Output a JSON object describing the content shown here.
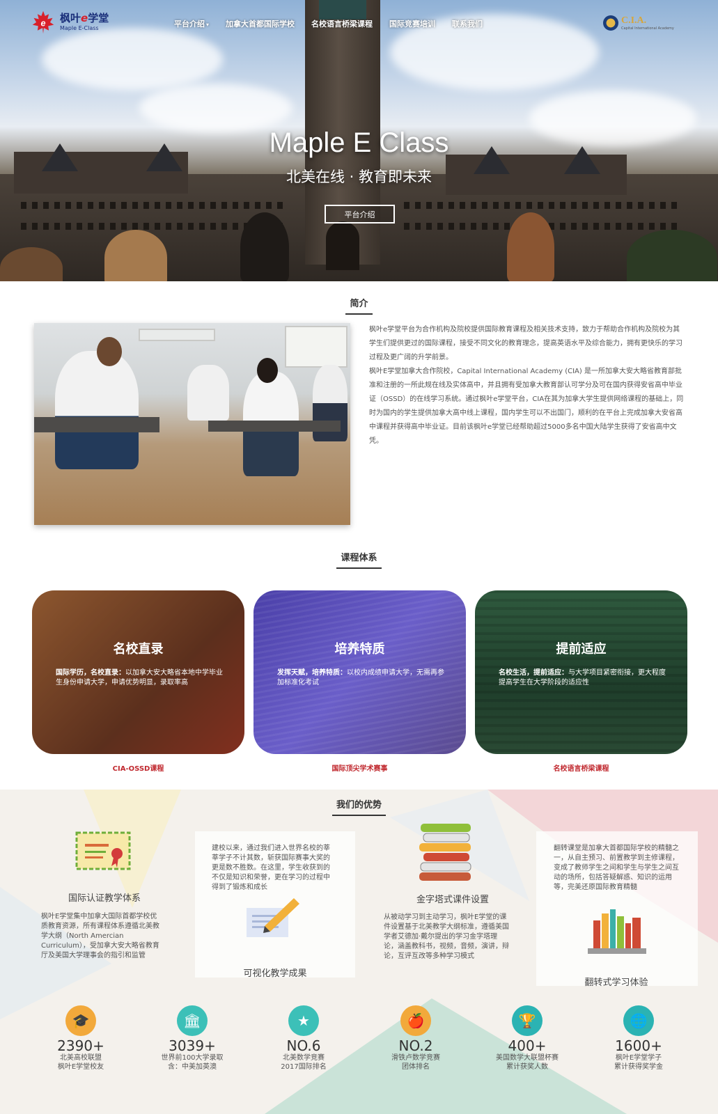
{
  "brand": {
    "name_pre": "枫叶",
    "name_e": "e",
    "name_post": "学堂",
    "sub": "Maple E-Class"
  },
  "nav": {
    "items": [
      {
        "label": "平台介绍",
        "caret": "▾"
      },
      {
        "label": "加拿大首都国际学校"
      },
      {
        "label": "名校语言桥梁课程"
      },
      {
        "label": "国际竞赛培训"
      },
      {
        "label": "联系我们"
      }
    ]
  },
  "partner": {
    "name": "C.I.A.",
    "sub": "Capital International Academy"
  },
  "hero": {
    "title": "Maple E Class",
    "subtitle": "北美在线 · 教育即未来",
    "button": "平台介绍"
  },
  "intro": {
    "title": "简介",
    "paragraphs": [
      "枫叶e学堂平台为合作机构及院校提供国际教育课程及相关技术支持，致力于帮助合作机构及院校为其学生们提供更过的国际课程，接受不同文化的教育理念，提高英语水平及综合能力，拥有更快乐的学习过程及更广阔的升学前景。",
      "枫叶E学堂加拿大合作院校，Capital International Academy (CIA) 是一所加拿大安大略省教育部批准和注册的一所此规在线及实体高中，并且拥有受加拿大教育部认可学分及可在国内获得安省高中毕业证（OSSD）的在线学习系统。通过枫叶e学堂平台，CIA在其为加拿大学生提供网络课程的基础上，同时为国内的学生提供加拿大高中线上课程，国内学生可以不出国门，顺利的在平台上完成加拿大安省高中课程并获得高中毕业证。目前该枫叶e学堂已经帮助超过5000多名中国大陆学生获得了安省高中文凭。"
    ]
  },
  "courses": {
    "title": "课程体系",
    "cards": [
      {
        "heading": "名校直录",
        "lead": "国际学历，名校直录：",
        "text": "以加拿大安大略省本地中学毕业生身份申请大学，申请优势明显，录取率高",
        "link": "CIA-OSSD课程"
      },
      {
        "heading": "培养特质",
        "lead": "发挥天赋，培养特质：",
        "text": "以校内成绩申请大学，无需再参加标准化考试",
        "link": "国际顶尖学术赛事"
      },
      {
        "heading": "提前适应",
        "lead": "名校生活，提前适应：",
        "text": "与大学项目紧密衔接，更大程度提高学生在大学阶段的适应性",
        "link": "名校语言桥梁课程"
      }
    ]
  },
  "advantages": {
    "title": "我们的优势",
    "items": [
      {
        "heading": "国际认证教学体系",
        "text": "枫叶E学堂集中加拿大国际首都学校优质教育资源，所有课程体系遵循北美教学大纲（North Amercian Curriculum），受加拿大安大略省教育厅及美国大学理事会的指引和监管"
      },
      {
        "heading": "可视化教学成果",
        "text": "建校以来，通过我们进入世界名校的莘莘学子不计其数，斩获国际赛事大奖的更是数不胜数。在这里，学生收获到的不仅是知识和荣誉，更在学习的过程中得到了锻炼和成长"
      },
      {
        "heading": "金字塔式课件设置",
        "text": "从被动学习到主动学习，枫叶E学堂的课件设置基于北美教学大纲标准，遵循美国学者艾德加·戴尔提出的学习金字塔理论，涵盖教科书，视频，音频，演讲，辩论，互评互改等多种学习模式"
      },
      {
        "heading": "翻转式学习体验",
        "text": "翻转课堂是加拿大首都国际学校的精髓之一，从自主预习、前置教学到主修课程，变成了教师学生之间和学生与学生之间互动的场所，包括答疑解惑、知识的运用等，完美还原国际教育精髓"
      }
    ]
  },
  "stats": [
    {
      "number": "2390+",
      "label1": "北美高校联盟",
      "label2": "枫叶E学堂校友",
      "icon": "graduates-icon",
      "color": "#f2a93b"
    },
    {
      "number": "3039+",
      "label1": "世界前100大学录取",
      "label2": "含：中美加英澳",
      "icon": "university-icon",
      "color": "#3cc0b8"
    },
    {
      "number": "NO.6",
      "label1": "北美数学竞赛",
      "label2": "2017国际排名",
      "icon": "medal-icon",
      "color": "#3cc0b8"
    },
    {
      "number": "NO.2",
      "label1": "滑铁卢数学竞赛",
      "label2": "团体排名",
      "icon": "apple-icon",
      "color": "#f2a93b"
    },
    {
      "number": "400+",
      "label1": "美国数学大联盟杯赛",
      "label2": "累计获奖人数",
      "icon": "trophy-icon",
      "color": "#2bb3b3"
    },
    {
      "number": "1600+",
      "label1": "枫叶E学堂学子",
      "label2": "累计获得奖学金",
      "icon": "globe-cap-icon",
      "color": "#2bb3b3"
    }
  ]
}
